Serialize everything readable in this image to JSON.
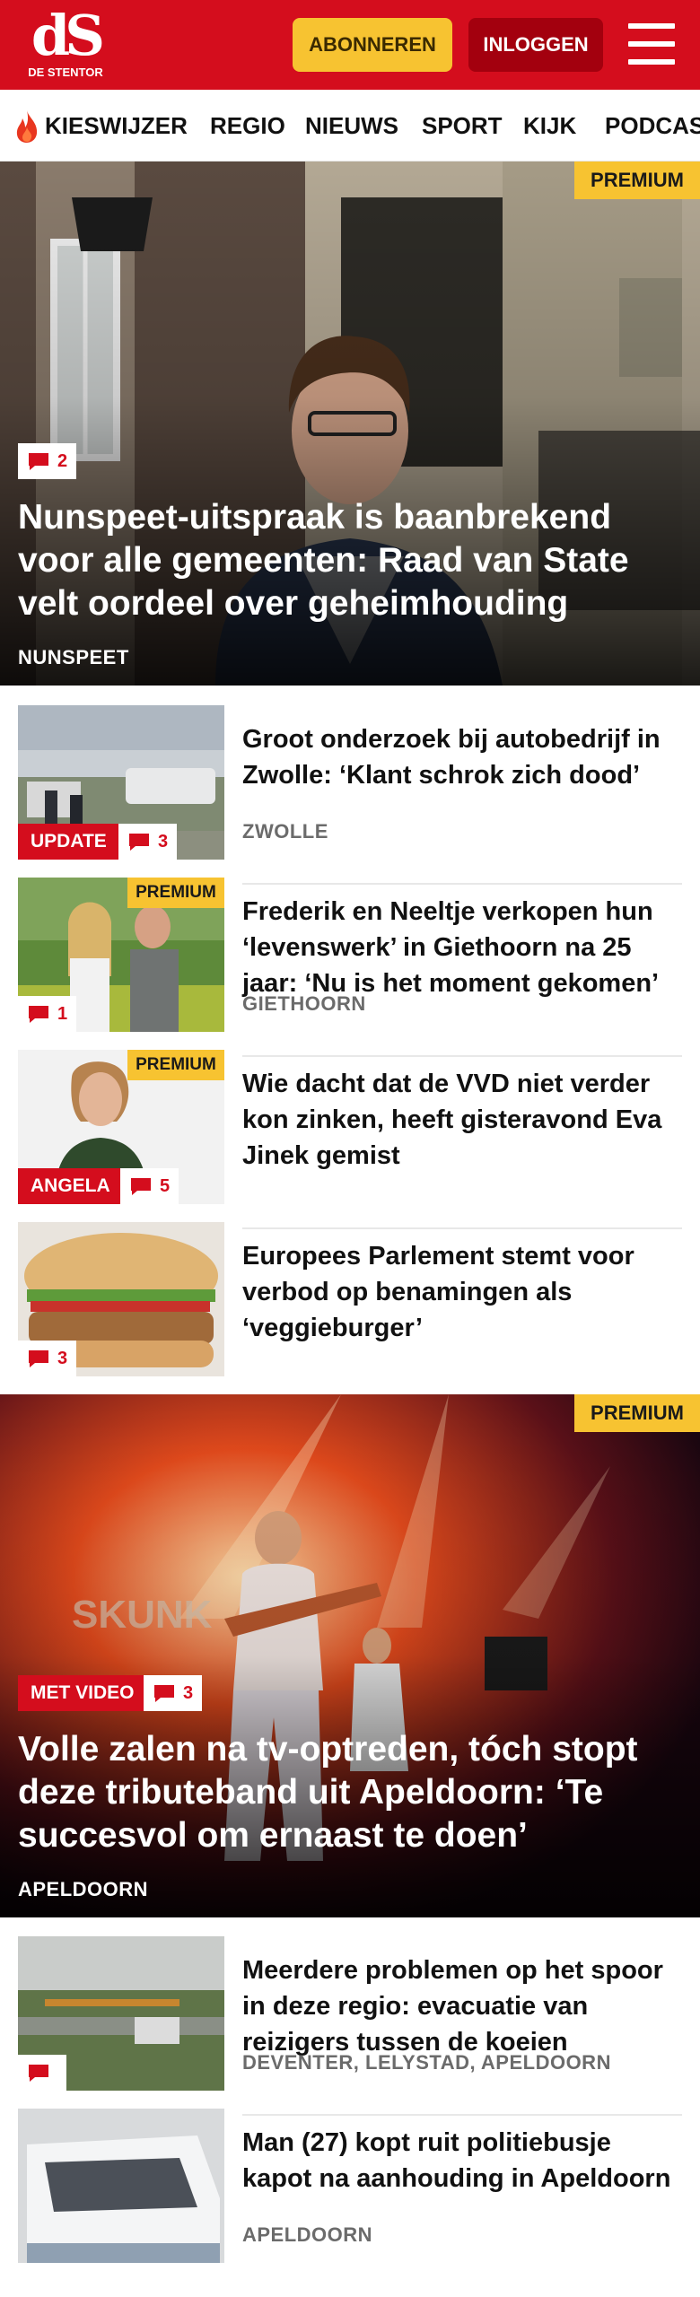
{
  "header": {
    "logo_mark": "dS",
    "logo_sub": "DE STENTOR",
    "subscribe_label": "ABONNEREN",
    "login_label": "INLOGGEN"
  },
  "nav": {
    "items": [
      "KIESWIJZER",
      "REGIO",
      "NIEUWS",
      "SPORT",
      "KIJK",
      "PODCAST"
    ]
  },
  "colors": {
    "brand_red": "#d40d1d",
    "premium_yellow": "#f7c331",
    "login_dark_red": "#a3000e"
  },
  "articles": {
    "hero1": {
      "premium": "PREMIUM",
      "comments": "2",
      "title": "Nunspeet-uitspraak is baanbrekend voor alle gemeenten: Raad van State velt oordeel over geheimhouding",
      "region": "NUNSPEET"
    },
    "list1": [
      {
        "title": "Groot onderzoek bij autobedrijf in Zwolle: ‘Klant schrok zich dood’",
        "region": "ZWOLLE",
        "label": "UPDATE",
        "comments": "3",
        "premium": ""
      },
      {
        "title": "Frederik en Neeltje verkopen hun ‘levenswerk’ in Giethoorn na 25 jaar: ‘Nu is het moment gekomen’",
        "region": "GIETHOORN",
        "label": "",
        "comments": "1",
        "premium": "PREMIUM"
      },
      {
        "title": "Wie dacht dat de VVD niet verder kon zinken, heeft gisteravond Eva Jinek gemist",
        "region": "",
        "label": "ANGELA",
        "comments": "5",
        "premium": "PREMIUM"
      },
      {
        "title": "Europees Parlement stemt voor verbod op benamingen als ‘veggieburger’",
        "region": "",
        "label": "",
        "comments": "3",
        "premium": ""
      }
    ],
    "hero2": {
      "premium": "PREMIUM",
      "label": "MET VIDEO",
      "comments": "3",
      "title": "Volle zalen na tv-optreden, tóch stopt deze tributeband uit Apeldoorn: ‘Te succesvol om ernaast te doen’",
      "region": "APELDOORN"
    },
    "list2": [
      {
        "title": "Meerdere problemen op het spoor in deze regio: evacuatie van reizigers tussen de koeien",
        "region": "DEVENTER, LELYSTAD, APELDOORN",
        "comments": ""
      },
      {
        "title": "Man (27) kopt ruit politiebusje kapot na aanhouding in Apeldoorn",
        "region": "APELDOORN",
        "comments": ""
      }
    ]
  }
}
